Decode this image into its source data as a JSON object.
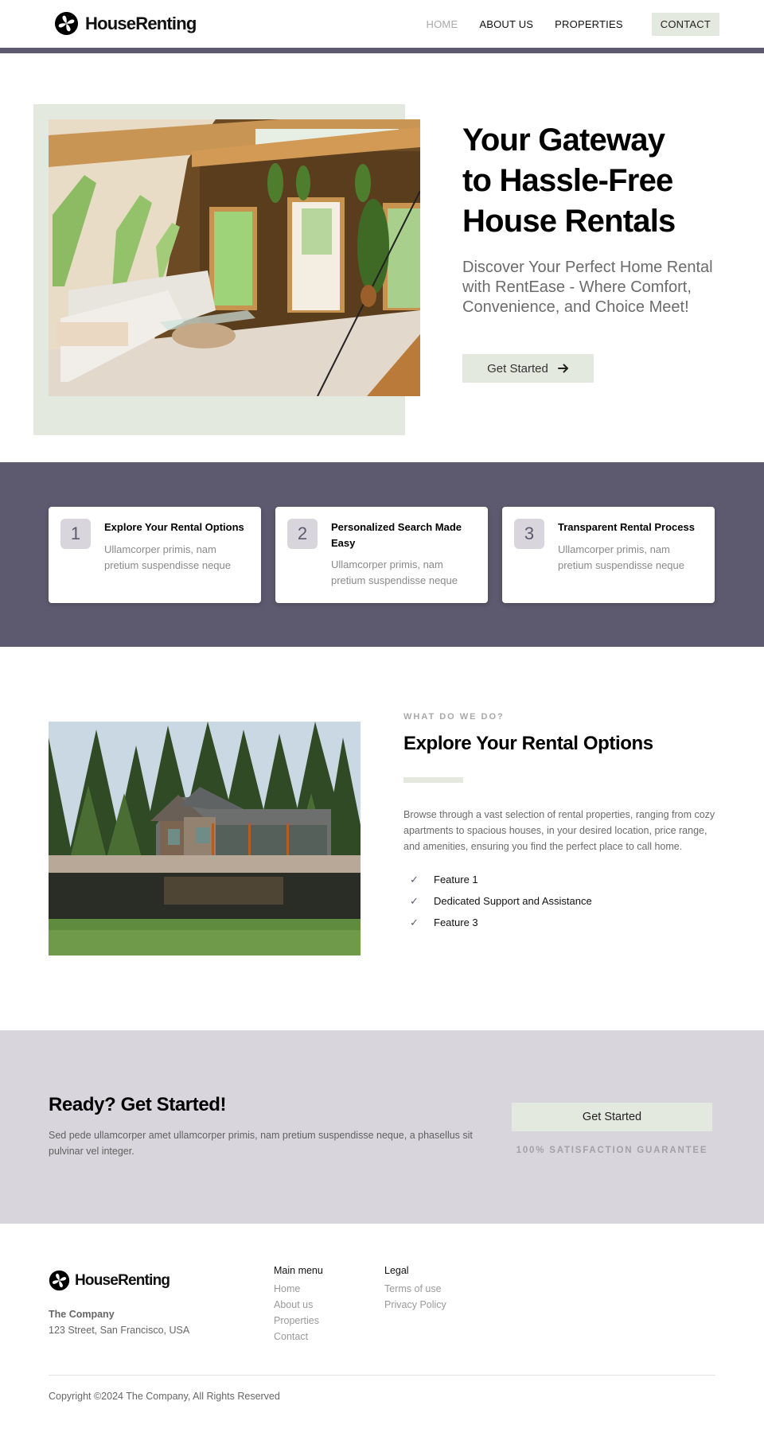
{
  "brand": {
    "name": "HouseRenting",
    "logo_icon": "pinwheel-circle-icon",
    "accent_color": "#e3e9de",
    "primary_dark": "#5d596e",
    "cta_background": "#d8d6dc"
  },
  "nav": {
    "items": [
      {
        "label": "HOME",
        "active": true
      },
      {
        "label": "ABOUT US",
        "active": false
      },
      {
        "label": "PROPERTIES",
        "active": false
      }
    ],
    "contact_label": "CONTACT"
  },
  "hero": {
    "title_lines": [
      "Your Gateway",
      "to Hassle-Free",
      "House Rentals"
    ],
    "subtitle": "Discover Your Perfect Home Rental with RentEase - Where Comfort, Convenience, and Choice Meet!",
    "button_label": "Get Started",
    "button_icon": "arrow-right-icon",
    "image_alt": "Bright A-frame cabin living room with white sofa, glass coffee table and plants"
  },
  "steps": [
    {
      "number": "1",
      "title": "Explore Your Rental Options",
      "description": "Ullamcorper primis, nam pretium suspendisse neque"
    },
    {
      "number": "2",
      "title": "Personalized Search Made Easy",
      "description": "Ullamcorper primis, nam pretium suspendisse neque"
    },
    {
      "number": "3",
      "title": "Transparent Rental Process",
      "description": "Ullamcorper primis, nam pretium suspendisse neque"
    }
  ],
  "what_we_do": {
    "eyebrow": "WHAT DO WE DO?",
    "title": "Explore Your Rental Options",
    "description": "Browse through a vast selection of rental properties, ranging from cozy apartments to spacious houses, in your desired location, price range, and amenities, ensuring you find the perfect place to call home.",
    "features": [
      "Feature 1",
      "Dedicated Support and Assistance",
      "Feature 3"
    ],
    "image_alt": "Cabin by a pond surrounded by pine trees"
  },
  "cta": {
    "title": "Ready? Get Started!",
    "description": "Sed pede ullamcorper amet ullamcorper primis, nam pretium suspendisse neque, a phasellus sit pulvinar vel integer.",
    "button_label": "Get Started",
    "guarantee": "100% SATISFACTION GUARANTEE"
  },
  "footer": {
    "company_name": "The Company",
    "address": "123 Street, San Francisco, USA",
    "main_menu": {
      "heading": "Main menu",
      "links": [
        "Home",
        "About us",
        "Properties",
        "Contact"
      ]
    },
    "legal": {
      "heading": "Legal",
      "links": [
        "Terms of use",
        "Privacy Policy"
      ]
    },
    "copyright": "Copyright ©2024 The Company, All Rights Reserved"
  }
}
